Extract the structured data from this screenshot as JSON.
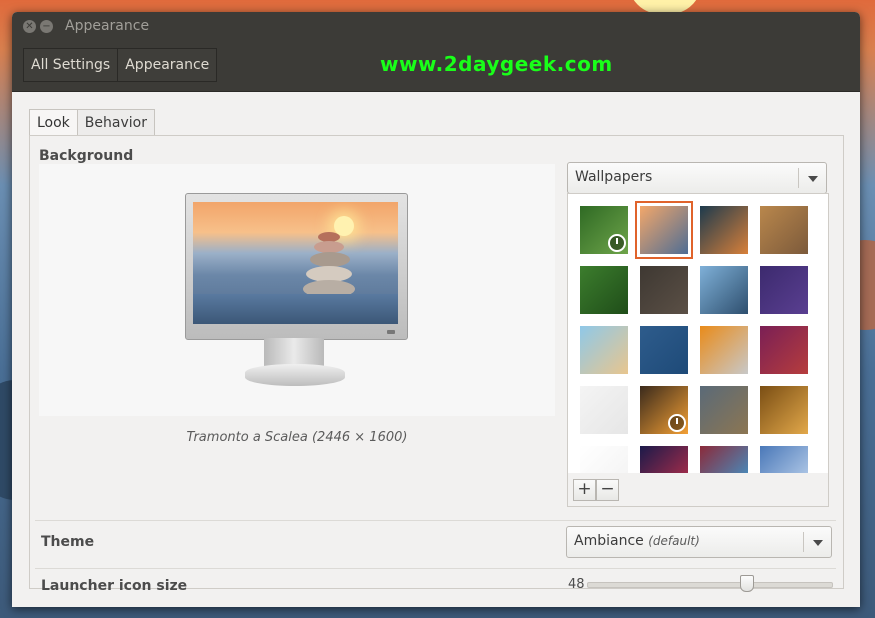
{
  "window": {
    "title": "Appearance"
  },
  "toolbar": {
    "breadcrumbs": [
      "All Settings",
      "Appearance"
    ],
    "watermark": "www.2daygeek.com"
  },
  "tabs": [
    {
      "label": "Look",
      "active": true
    },
    {
      "label": "Behavior",
      "active": false
    }
  ],
  "background": {
    "section_label": "Background",
    "source_select": "Wallpapers",
    "caption": "Tramonto a Scalea (2446 × 1600)",
    "selected_wallpaper_index": 1
  },
  "wallpaper_grid": {
    "add_label": "+",
    "remove_label": "−",
    "thumbnails": [
      {
        "name": "green-leaves-timed",
        "colors": [
          "#2f6a24",
          "#6ea44a"
        ],
        "timed": true
      },
      {
        "name": "tramonto-a-scalea",
        "colors": [
          "#f3a76a",
          "#4e6d94"
        ],
        "timed": false
      },
      {
        "name": "spiky-orange-flower",
        "colors": [
          "#1d3a4d",
          "#d8803a"
        ],
        "timed": false
      },
      {
        "name": "golden-grass",
        "colors": [
          "#b9874c",
          "#7c5a3b"
        ],
        "timed": false
      },
      {
        "name": "clover-leaves",
        "colors": [
          "#3c7d2d",
          "#1f4d19"
        ],
        "timed": false
      },
      {
        "name": "dark-brown-blur",
        "colors": [
          "#3e3832",
          "#5b5046"
        ],
        "timed": false
      },
      {
        "name": "palm-fronds",
        "colors": [
          "#7fb0d8",
          "#2e4f6e"
        ],
        "timed": false
      },
      {
        "name": "purple-texture",
        "colors": [
          "#3c2a6e",
          "#5a3f91"
        ],
        "timed": false
      },
      {
        "name": "tall-building",
        "colors": [
          "#8fc8e8",
          "#e8c68e"
        ],
        "timed": false
      },
      {
        "name": "blue-water",
        "colors": [
          "#2e5c8c",
          "#1e4a78"
        ],
        "timed": false
      },
      {
        "name": "orange-curve",
        "colors": [
          "#e98b1a",
          "#c8c8c8"
        ],
        "timed": false
      },
      {
        "name": "magenta-gradient",
        "colors": [
          "#7a1f55",
          "#b63d3d"
        ],
        "timed": false
      },
      {
        "name": "white-paper",
        "colors": [
          "#f4f4f4",
          "#e6e6e6"
        ],
        "timed": false
      },
      {
        "name": "sunset-timed",
        "colors": [
          "#3a2a1c",
          "#f3a035"
        ],
        "timed": true
      },
      {
        "name": "bench-road",
        "colors": [
          "#5a6a78",
          "#8c7652"
        ],
        "timed": false
      },
      {
        "name": "cracked-earth",
        "colors": [
          "#7a4e14",
          "#e2a84a"
        ],
        "timed": false
      },
      {
        "name": "blank-placeholder",
        "colors": [
          "#ffffff",
          "#f2f2f2"
        ],
        "timed": false
      },
      {
        "name": "night-lights",
        "colors": [
          "#1b1a4a",
          "#c0304a"
        ],
        "timed": false
      },
      {
        "name": "record-player",
        "colors": [
          "#8b2a3a",
          "#3aa0d8"
        ],
        "timed": false
      },
      {
        "name": "blue-glow",
        "colors": [
          "#4a78b8",
          "#c4d8f0"
        ],
        "timed": false
      }
    ]
  },
  "theme": {
    "label": "Theme",
    "value": "Ambiance",
    "value_suffix": "(default)"
  },
  "launcher": {
    "label": "Launcher icon size",
    "value": "48",
    "slider_fraction": 0.65
  }
}
